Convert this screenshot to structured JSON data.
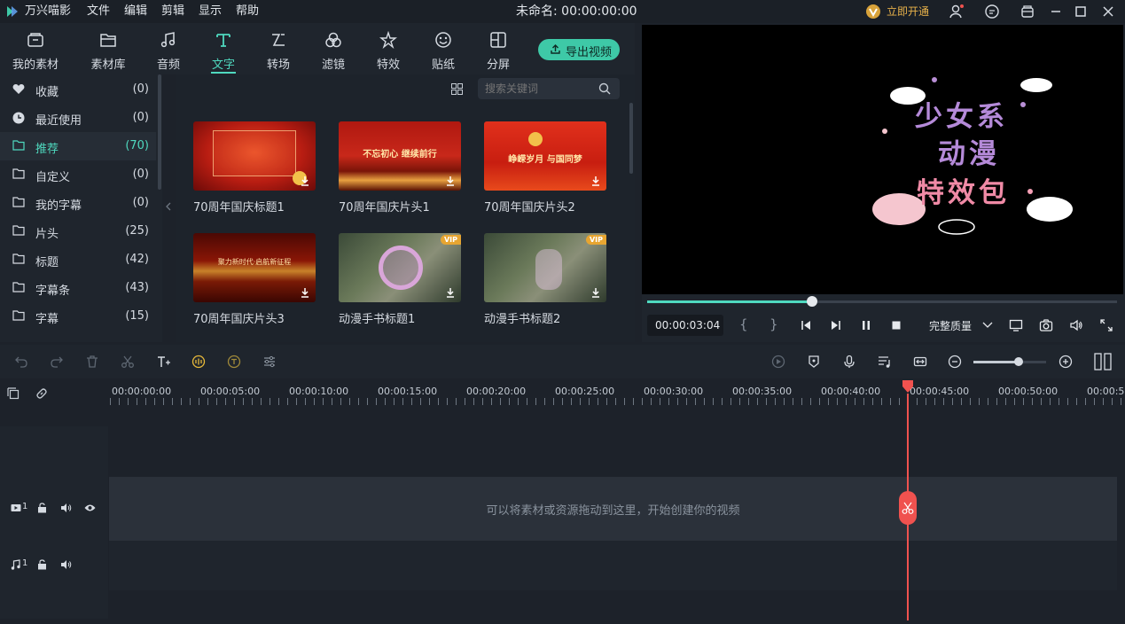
{
  "app": {
    "name": "万兴喵影",
    "menus": [
      "文件",
      "编辑",
      "剪辑",
      "显示",
      "帮助"
    ],
    "project_title": "未命名: 00:00:00:00",
    "vip_label": "立即开通"
  },
  "toolbar": {
    "tabs": [
      {
        "label": "我的素材",
        "icon": "folder-box-icon"
      },
      {
        "label": "素材库",
        "icon": "folder-icon"
      },
      {
        "label": "音频",
        "icon": "music-note-icon"
      },
      {
        "label": "文字",
        "icon": "text-icon"
      },
      {
        "label": "转场",
        "icon": "transition-icon"
      },
      {
        "label": "滤镜",
        "icon": "filter-icon"
      },
      {
        "label": "特效",
        "icon": "effects-icon"
      },
      {
        "label": "贴纸",
        "icon": "sticker-icon"
      },
      {
        "label": "分屏",
        "icon": "split-screen-icon"
      }
    ],
    "active_tab": "文字",
    "export_label": "导出视频"
  },
  "sidebar": {
    "items": [
      {
        "label": "收藏",
        "count": "(0)",
        "icon": "heart-icon"
      },
      {
        "label": "最近使用",
        "count": "(0)",
        "icon": "clock-icon"
      },
      {
        "label": "推荐",
        "count": "(70)",
        "icon": "folder-icon",
        "selected": true
      },
      {
        "label": "自定义",
        "count": "(0)",
        "icon": "folder-icon"
      },
      {
        "label": "我的字幕",
        "count": "(0)",
        "icon": "folder-icon"
      },
      {
        "label": "片头",
        "count": "(25)",
        "icon": "folder-icon"
      },
      {
        "label": "标题",
        "count": "(42)",
        "icon": "folder-icon"
      },
      {
        "label": "字幕条",
        "count": "(43)",
        "icon": "folder-icon"
      },
      {
        "label": "字幕",
        "count": "(15)",
        "icon": "folder-icon"
      }
    ]
  },
  "search": {
    "placeholder": "搜索关键词"
  },
  "grid": {
    "items": [
      {
        "title": "70周年国庆标题1",
        "vip": false,
        "thumb_text": ""
      },
      {
        "title": "70周年国庆片头1",
        "vip": false,
        "thumb_text": "不忘初心 继续前行"
      },
      {
        "title": "70周年国庆片头2",
        "vip": false,
        "thumb_text": "峥嵘岁月 与国同梦"
      },
      {
        "title": "70周年国庆片头3",
        "vip": false,
        "thumb_text": "聚力新时代·启航新征程"
      },
      {
        "title": "动漫手书标题1",
        "vip": true,
        "thumb_text": ""
      },
      {
        "title": "动漫手书标题2",
        "vip": true,
        "thumb_text": ""
      }
    ],
    "vip_badge": "VIP"
  },
  "preview": {
    "lines": [
      "少女系",
      "动漫",
      "特效包"
    ]
  },
  "player": {
    "time": "00:00:03:04",
    "mark_in": "{",
    "mark_out": "}",
    "quality": "完整质量",
    "progress": 0.35
  },
  "timeline": {
    "ruler": [
      "00:00:00:00",
      "00:00:05:00",
      "00:00:10:00",
      "00:00:15:00",
      "00:00:20:00",
      "00:00:25:00",
      "00:00:30:00",
      "00:00:35:00",
      "00:00:40:00",
      "00:00:45:00",
      "00:00:50:00",
      "00:00:5"
    ],
    "zoom": 0.62,
    "video_track_label": "1",
    "audio_track_label": "1",
    "drop_hint": "可以将素材或资源拖动到这里，开始创建你的视频"
  },
  "colors": {
    "accent": "#4fd9bf",
    "export": "#3ec9a7",
    "playhead": "#f0524f",
    "vip": "#e7a531"
  }
}
